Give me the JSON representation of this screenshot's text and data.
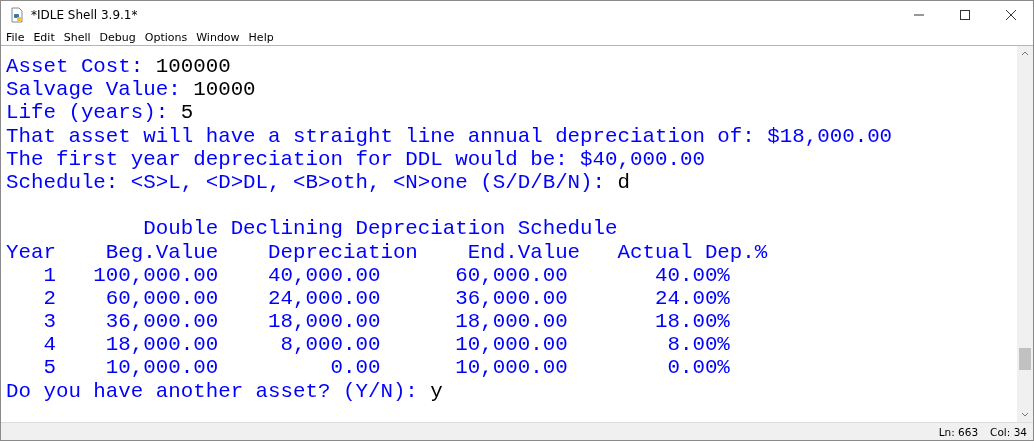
{
  "window": {
    "title": "*IDLE Shell 3.9.1*"
  },
  "menu": [
    "File",
    "Edit",
    "Shell",
    "Debug",
    "Options",
    "Window",
    "Help"
  ],
  "shell_lines": [
    {
      "kind": "prompt",
      "output": "Asset Cost: ",
      "input": "100000"
    },
    {
      "kind": "prompt",
      "output": "Salvage Value: ",
      "input": "10000"
    },
    {
      "kind": "prompt",
      "output": "Life (years): ",
      "input": "5"
    },
    {
      "kind": "text",
      "output": "That asset will have a straight line annual depreciation of: $18,000.00"
    },
    {
      "kind": "text",
      "output": "The first year depreciation for DDL would be: $40,000.00"
    },
    {
      "kind": "prompt",
      "output": "Schedule: <S>L, <D>DL, <B>oth, <N>one (S/D/B/N): ",
      "input": "d"
    },
    {
      "kind": "blank"
    },
    {
      "kind": "text",
      "output": "           Double Declining Depreciation Schedule"
    },
    {
      "kind": "text",
      "output": "Year    Beg.Value    Depreciation    End.Value   Actual Dep.%"
    },
    {
      "kind": "text",
      "output": "   1   100,000.00    40,000.00      60,000.00       40.00%"
    },
    {
      "kind": "text",
      "output": "   2    60,000.00    24,000.00      36,000.00       24.00%"
    },
    {
      "kind": "text",
      "output": "   3    36,000.00    18,000.00      18,000.00       18.00%"
    },
    {
      "kind": "text",
      "output": "   4    18,000.00     8,000.00      10,000.00        8.00%"
    },
    {
      "kind": "text",
      "output": "   5    10,000.00         0.00      10,000.00        0.00%"
    },
    {
      "kind": "prompt",
      "output": "Do you have another asset? (Y/N): ",
      "input": "y"
    }
  ],
  "status_bar": {
    "line": "Ln: 663",
    "column": "Col: 34"
  }
}
